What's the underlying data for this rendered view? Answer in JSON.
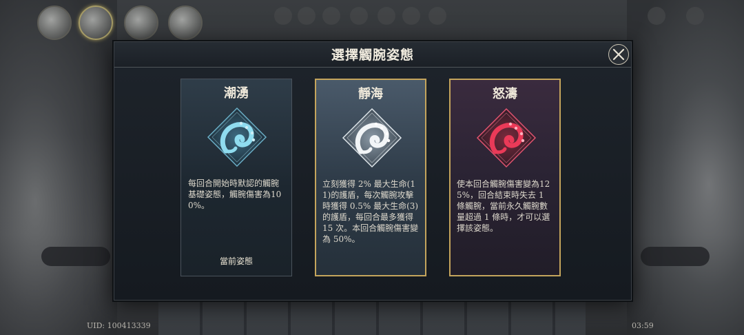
{
  "modal": {
    "title": "選擇觸腕姿態",
    "close_icon": "close-x-icon"
  },
  "stances": [
    {
      "name": "潮湧",
      "icon": "tentacle-emblem-icon",
      "color": "#7fd0e6",
      "description": "每回合開始時默認的觸腕基礎姿態，觸腕傷害為100%。",
      "status": "當前姿態"
    },
    {
      "name": "靜海",
      "icon": "tentacle-emblem-icon",
      "color": "#e9eef2",
      "description": "立刻獲得 2% 最大生命(11)的護盾，每次觸腕攻擊時獲得 0.5% 最大生命(3)的護盾，每回合最多獲得 15 次。本回合觸腕傷害變為 50%。",
      "status": ""
    },
    {
      "name": "怒濤",
      "icon": "tentacle-emblem-icon",
      "color": "#e23a55",
      "description": "使本回合觸腕傷害變為125%，回合結束時失去 1 條觸腕，當前永久觸腕數量超過 1 條時，才可以選擇該姿態。",
      "status": ""
    }
  ],
  "footer": {
    "uid": "UID: 100413339",
    "time": "03:59"
  },
  "accent_gold": "#c5a55c"
}
